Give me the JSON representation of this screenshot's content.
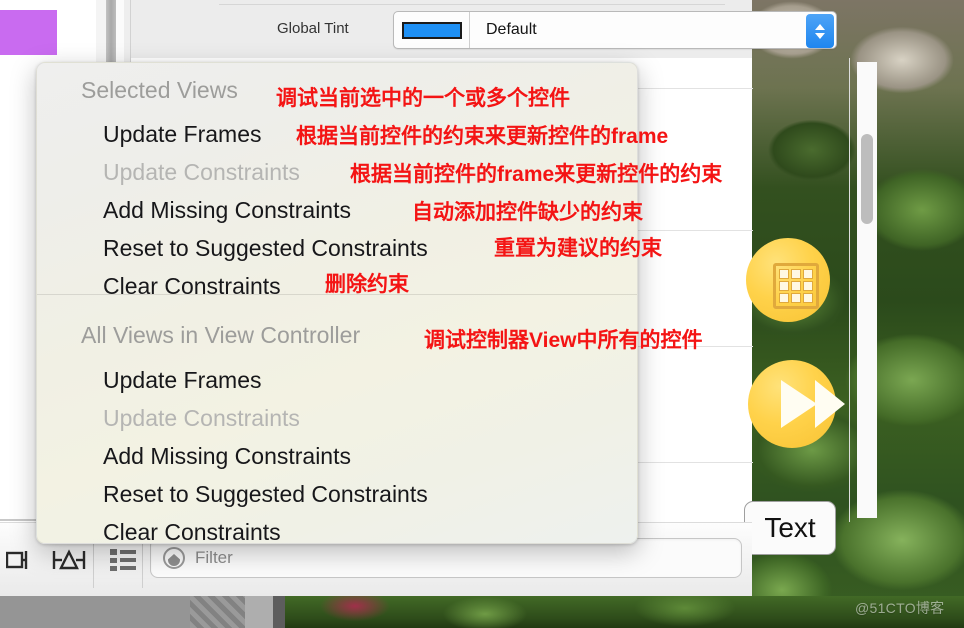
{
  "inspector": {
    "global_tint_label": "Global Tint",
    "global_tint_value": "Default",
    "swatch_color": "#1e90f5",
    "stepper_name": "stepper"
  },
  "canvas": {
    "text_button_label": "Text"
  },
  "bottom_toolbar": {
    "icons": [
      {
        "name": "align-icon",
        "glyph": "↦"
      },
      {
        "name": "pin-icon",
        "glyph": "⊢"
      },
      {
        "name": "document-outline-icon",
        "glyph": "☰"
      }
    ],
    "filter_placeholder": "Filter",
    "filter_value": ""
  },
  "menu": {
    "sections": [
      {
        "header": "Selected Views",
        "header_annotation": "调试当前选中的一个或多个控件",
        "items": [
          {
            "label": "Update Frames",
            "enabled": true,
            "annotation": "根据当前控件的约束来更新控件的frame"
          },
          {
            "label": "Update Constraints",
            "enabled": false,
            "annotation": "根据当前控件的frame来更新控件的约束"
          },
          {
            "label": "Add Missing Constraints",
            "enabled": true,
            "annotation": "自动添加控件缺少的约束"
          },
          {
            "label": "Reset to Suggested Constraints",
            "enabled": true,
            "annotation": "重置为建议的约束"
          },
          {
            "label": "Clear Constraints",
            "enabled": true,
            "annotation": "删除约束"
          }
        ]
      },
      {
        "header": "All Views in View Controller",
        "header_annotation": "调试控制器View中所有的控件",
        "items": [
          {
            "label": "Update Frames",
            "enabled": true,
            "annotation": ""
          },
          {
            "label": "Update Constraints",
            "enabled": false,
            "annotation": ""
          },
          {
            "label": "Add Missing Constraints",
            "enabled": true,
            "annotation": ""
          },
          {
            "label": "Reset to Suggested Constraints",
            "enabled": true,
            "annotation": ""
          },
          {
            "label": "Clear Constraints",
            "enabled": true,
            "annotation": ""
          }
        ]
      }
    ]
  },
  "watermark": "@51CTO博客",
  "colors": {
    "annotation_red": "#f41414",
    "accent_blue": "#1e90f5",
    "swatch_purple": "#c96bf0",
    "highlight_yellow": "#ffd24a"
  }
}
